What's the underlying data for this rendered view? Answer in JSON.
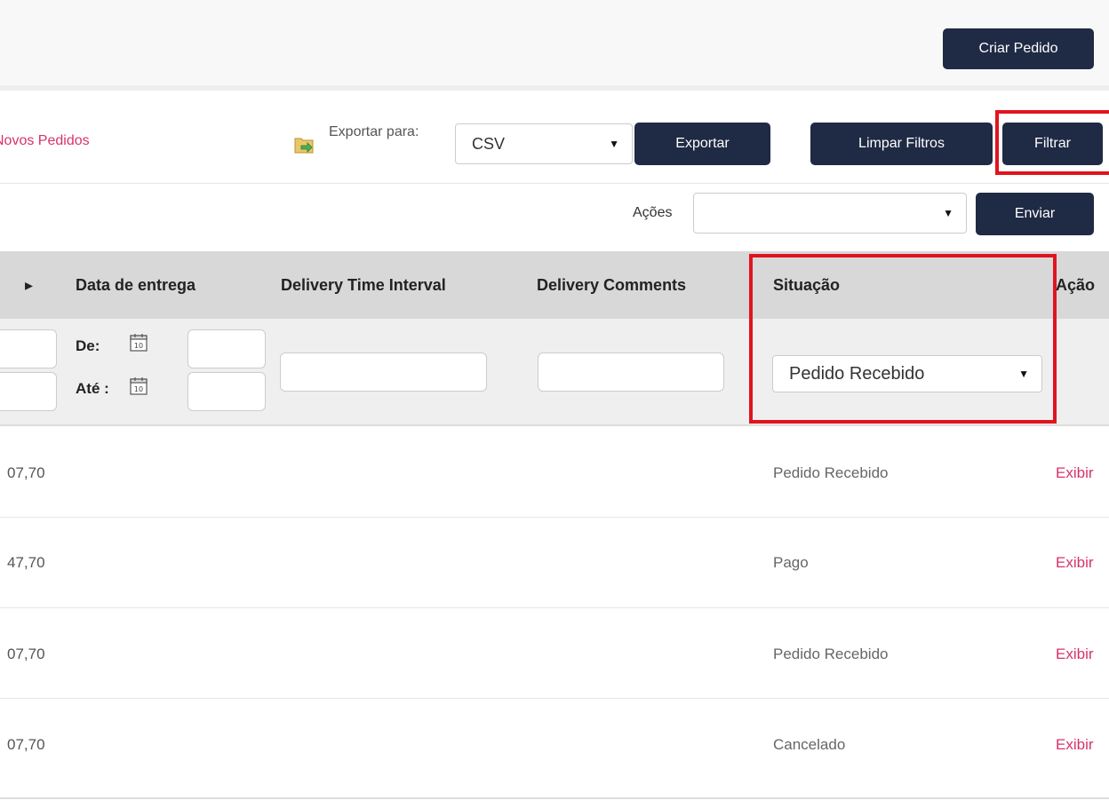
{
  "header": {
    "create_order_label": "Criar Pedido"
  },
  "toolbar": {
    "new_orders_link": "Novos Pedidos",
    "export_label": "Exportar para:",
    "export_format": "CSV",
    "export_button": "Exportar",
    "clear_filters_button": "Limpar Filtros",
    "filter_button": "Filtrar"
  },
  "actions": {
    "label": "Ações",
    "selected": "",
    "send_button": "Enviar"
  },
  "table": {
    "columns": [
      "",
      "Data de entrega",
      "Delivery Time Interval",
      "Delivery Comments",
      "Situação",
      "Ação"
    ],
    "filters": {
      "date_from_label": "De:",
      "date_to_label": "Até :",
      "status_selected": "Pedido Recebido"
    },
    "rows": [
      {
        "value": "07,70",
        "status": "Pedido Recebido",
        "action": "Exibir"
      },
      {
        "value": "47,70",
        "status": "Pago",
        "action": "Exibir"
      },
      {
        "value": "07,70",
        "status": "Pedido Recebido",
        "action": "Exibir"
      },
      {
        "value": "07,70",
        "status": "Cancelado",
        "action": "Exibir"
      }
    ]
  },
  "icons": {
    "export": "export-file-icon",
    "calendar": "calendar-icon",
    "caret": "dropdown-caret-icon"
  },
  "colors": {
    "primary_button": "#1f2a44",
    "link": "#d6336c",
    "highlight": "#e0141e"
  }
}
